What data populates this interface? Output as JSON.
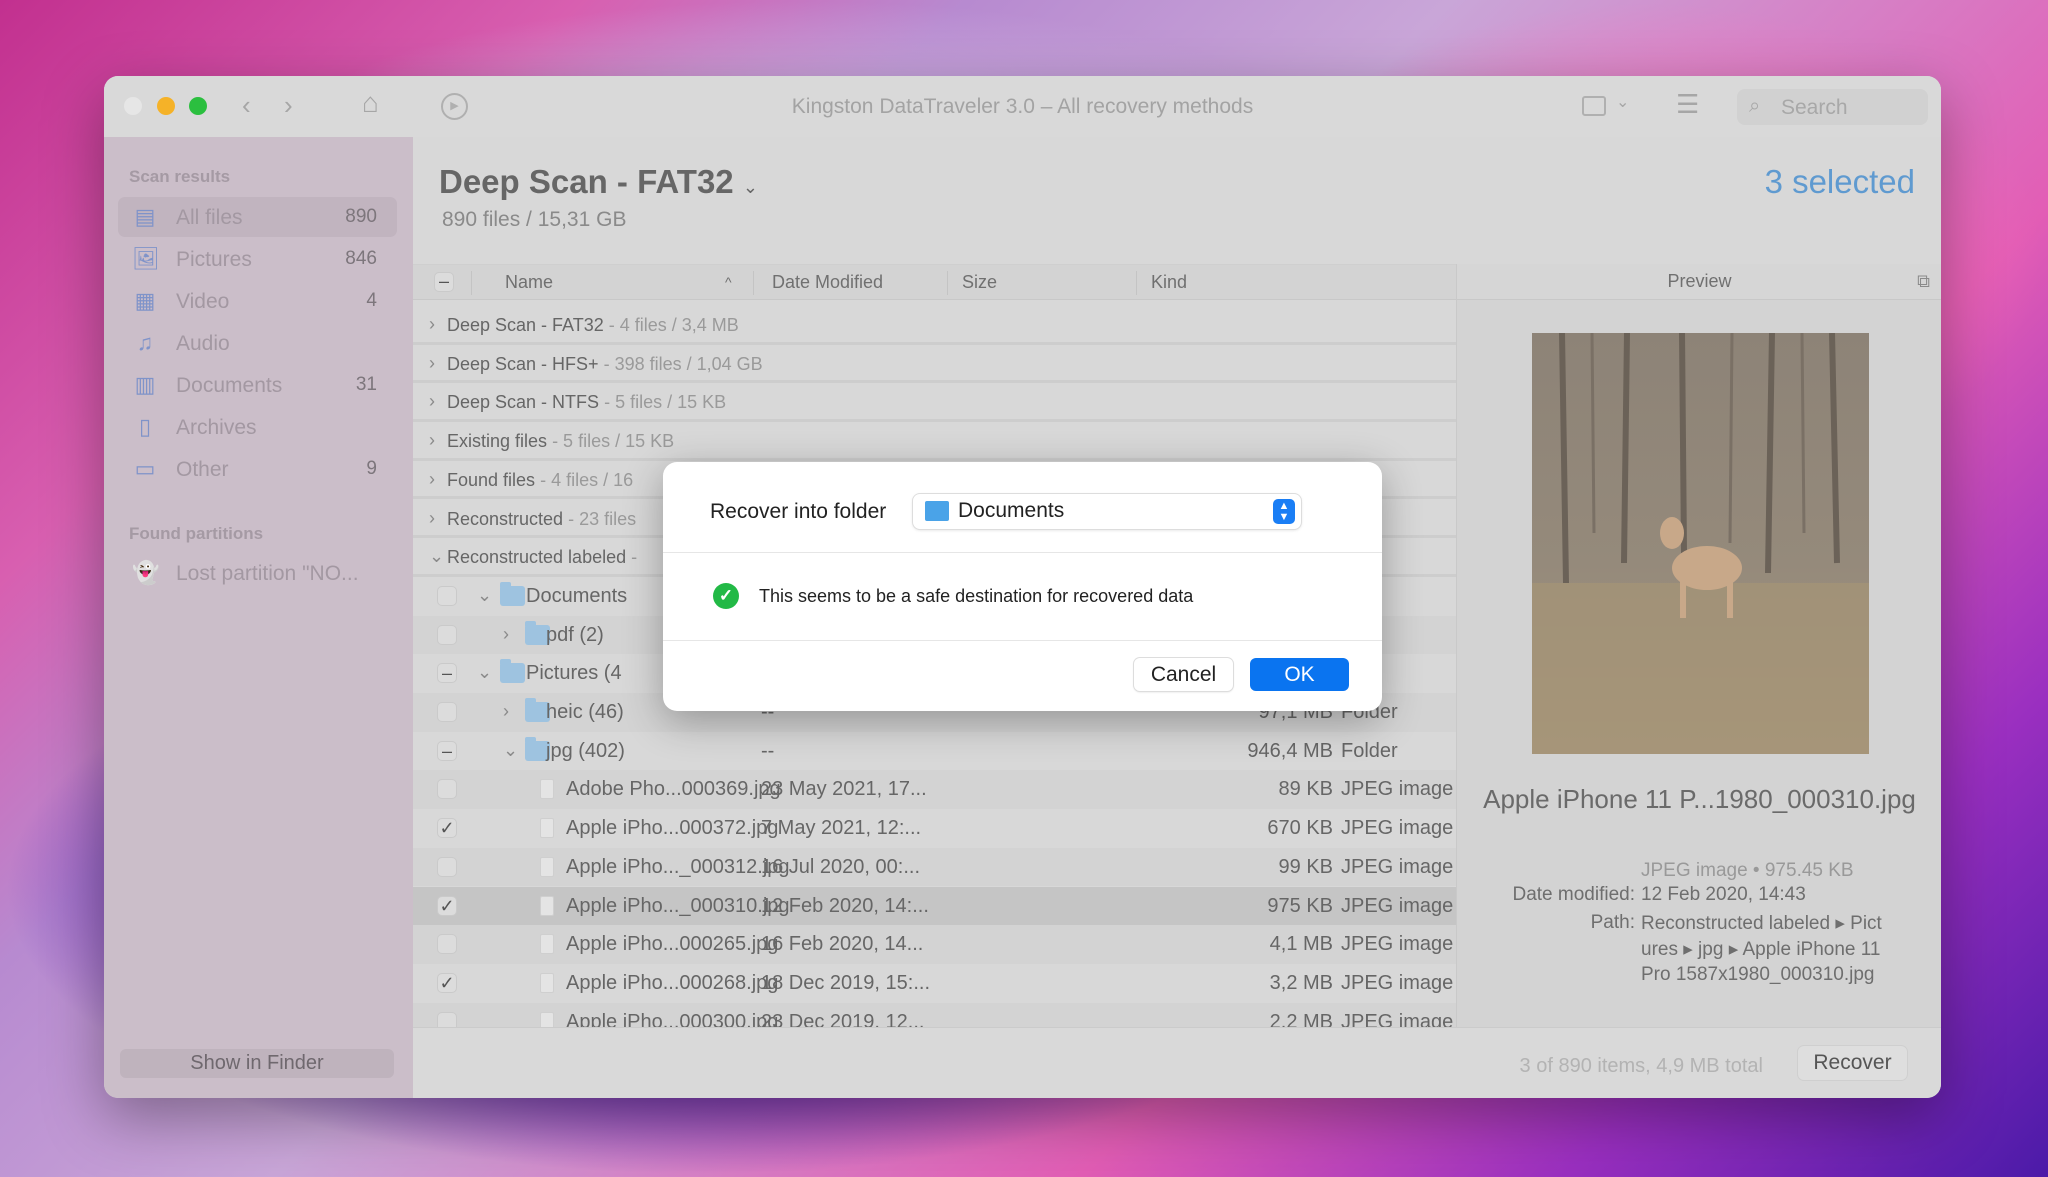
{
  "window": {
    "title": "Kingston DataTraveler 3.0 – All recovery methods",
    "search_placeholder": "Search"
  },
  "sidebar": {
    "scan_results_label": "Scan results",
    "items": [
      {
        "label": "All files",
        "count": "890",
        "icon": "all-files-icon",
        "active": true
      },
      {
        "label": "Pictures",
        "count": "846",
        "icon": "pictures-icon"
      },
      {
        "label": "Video",
        "count": "4",
        "icon": "video-icon"
      },
      {
        "label": "Audio",
        "count": "",
        "icon": "audio-icon"
      },
      {
        "label": "Documents",
        "count": "31",
        "icon": "documents-icon"
      },
      {
        "label": "Archives",
        "count": "",
        "icon": "archives-icon"
      },
      {
        "label": "Other",
        "count": "9",
        "icon": "other-icon"
      }
    ],
    "found_partitions_label": "Found partitions",
    "partitions": [
      {
        "label": "Lost partition \"NO...",
        "icon": "ghost-icon"
      }
    ],
    "show_in_finder": "Show in Finder"
  },
  "main": {
    "title": "Deep Scan - FAT32",
    "subtitle": "890 files / 15,31 GB",
    "selected": "3 selected",
    "columns": {
      "name": "Name",
      "date": "Date Modified",
      "size": "Size",
      "kind": "Kind"
    },
    "rows": [
      {
        "type": "group",
        "name": "Deep Scan - FAT32",
        "meta": "- 4 files / 3,4 MB",
        "expanded": false
      },
      {
        "type": "group",
        "name": "Deep Scan - HFS+",
        "meta": "- 398 files / 1,04 GB",
        "expanded": false
      },
      {
        "type": "group",
        "name": "Deep Scan - NTFS",
        "meta": "- 5 files / 15 KB",
        "expanded": false
      },
      {
        "type": "group",
        "name": "Existing files",
        "meta": "- 5 files / 15 KB",
        "expanded": false
      },
      {
        "type": "group",
        "name": "Found files",
        "meta": "- 4 files / 16",
        "expanded": false
      },
      {
        "type": "group",
        "name": "Reconstructed",
        "meta": "- 23 files",
        "expanded": false
      },
      {
        "type": "group",
        "name": "Reconstructed labeled",
        "meta": "-",
        "expanded": true
      },
      {
        "type": "folder",
        "level": 1,
        "name": "Documents",
        "check": "off",
        "expanded": true,
        "date": "",
        "size": "",
        "kind": ""
      },
      {
        "type": "folder",
        "level": 2,
        "name": "pdf (2)",
        "check": "off",
        "expanded": false,
        "date": "",
        "size": "",
        "kind": ""
      },
      {
        "type": "folder",
        "level": 1,
        "name": "Pictures (4",
        "check": "mixed",
        "expanded": true,
        "date": "",
        "size": "",
        "kind": ""
      },
      {
        "type": "folder",
        "level": 2,
        "name": "heic (46)",
        "check": "off",
        "expanded": false,
        "date": "--",
        "size": "97,1 MB",
        "kind": "Folder"
      },
      {
        "type": "folder",
        "level": 2,
        "name": "jpg (402)",
        "check": "mixed",
        "expanded": true,
        "date": "--",
        "size": "946,4 MB",
        "kind": "Folder"
      },
      {
        "type": "file",
        "name": "Adobe Pho...000369.jpg",
        "check": "off",
        "date": "23 May 2021, 17...",
        "size": "89 KB",
        "kind": "JPEG image"
      },
      {
        "type": "file",
        "name": "Apple iPho...000372.jpg",
        "check": "on",
        "date": "7 May 2021, 12:...",
        "size": "670 KB",
        "kind": "JPEG image"
      },
      {
        "type": "file",
        "name": "Apple iPho..._000312.jpg",
        "check": "off",
        "date": "16 Jul 2020, 00:...",
        "size": "99 KB",
        "kind": "JPEG image"
      },
      {
        "type": "file",
        "name": "Apple iPho..._000310.jpg",
        "check": "on",
        "date": "12 Feb 2020, 14:...",
        "size": "975 KB",
        "kind": "JPEG image",
        "selected": true
      },
      {
        "type": "file",
        "name": "Apple iPho...000265.jpg",
        "check": "off",
        "date": "16 Feb 2020, 14...",
        "size": "4,1 MB",
        "kind": "JPEG image"
      },
      {
        "type": "file",
        "name": "Apple iPho...000268.jpg",
        "check": "on",
        "date": "18 Dec 2019, 15:...",
        "size": "3,2 MB",
        "kind": "JPEG image"
      },
      {
        "type": "file",
        "name": "Apple iPho...000300.jpg",
        "check": "off",
        "date": "23 Dec 2019, 12...",
        "size": "2,2 MB",
        "kind": "JPEG image"
      }
    ]
  },
  "preview": {
    "header": "Preview",
    "filename": "Apple iPhone 11 P...1980_000310.jpg",
    "type_size": "JPEG image • 975.45 KB",
    "date_label": "Date modified:",
    "date_value": "12 Feb 2020, 14:43",
    "path_label": "Path:",
    "path_lines": [
      "Reconstructed labeled ▸ Pict",
      "ures ▸ jpg ▸ Apple iPhone 11",
      "Pro 1587x1980_000310.jpg"
    ]
  },
  "footer": {
    "summary": "3 of 890 items, 4,9 MB total",
    "recover": "Recover"
  },
  "dialog": {
    "label": "Recover into folder",
    "folder": "Documents",
    "message": "This seems to be a safe destination for recovered data",
    "cancel": "Cancel",
    "ok": "OK"
  },
  "colors": {
    "accent": "#0a74f0",
    "success": "#22b946",
    "selected_text": "#5f9ad0"
  }
}
